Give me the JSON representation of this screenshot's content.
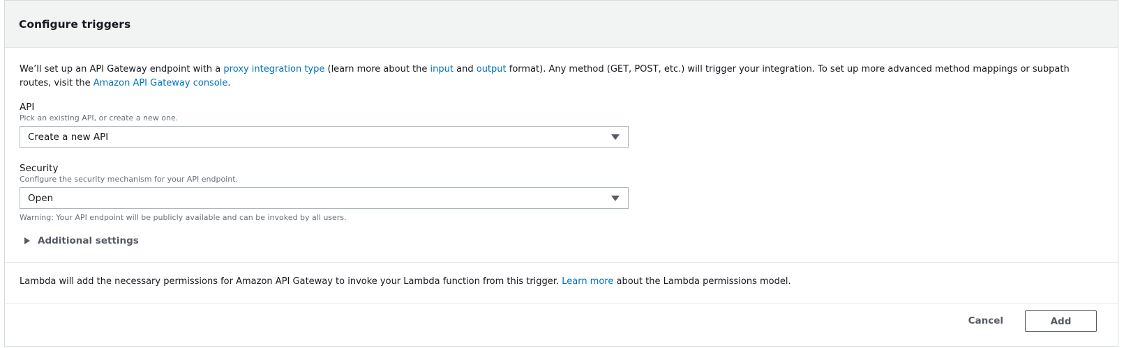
{
  "panel": {
    "title": "Configure triggers"
  },
  "intro": {
    "part1": "We’ll set up an API Gateway endpoint with a ",
    "link_proxy": "proxy integration type",
    "part2": " (learn more about the ",
    "link_input": "input",
    "part3": " and ",
    "link_output": "output",
    "part4": " format). Any method (GET, POST, etc.) will trigger your integration. To set up more advanced method mappings or subpath routes, visit the ",
    "link_console": "Amazon API Gateway console",
    "part5": "."
  },
  "api_field": {
    "label": "API",
    "description": "Pick an existing API, or create a new one.",
    "selected": "Create a new API"
  },
  "security_field": {
    "label": "Security",
    "description": "Configure the security mechanism for your API endpoint.",
    "selected": "Open",
    "warning": "Warning: Your API endpoint will be publicly available and can be invoked by all users."
  },
  "additional_settings": {
    "label": "Additional settings"
  },
  "permissions": {
    "part1": "Lambda will add the necessary permissions for Amazon API Gateway to invoke your Lambda function from this trigger. ",
    "link": "Learn more",
    "part2": " about the Lambda permissions model."
  },
  "footer": {
    "cancel_label": "Cancel",
    "add_label": "Add"
  },
  "colors": {
    "link": "#0073bb",
    "header_bg": "#f2f3f3",
    "border": "#d5dbdb"
  },
  "icons": {
    "select_caret": "caret-down-icon",
    "expander": "caret-right-icon"
  }
}
